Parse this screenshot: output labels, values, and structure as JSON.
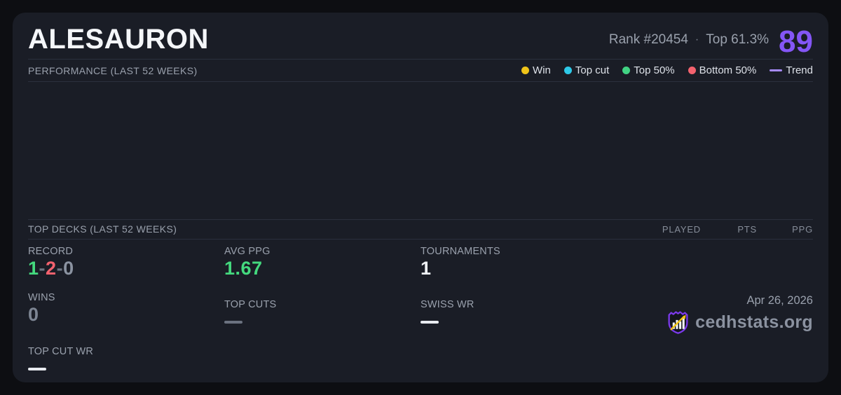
{
  "page": {
    "background": "#0d0e12",
    "card_background": "#1a1d26"
  },
  "header": {
    "title": "ALESAURON",
    "rank_text": "Rank #20454",
    "separator": "·",
    "top_percent_text": "Top 61.3%",
    "score": "89",
    "score_color": "#8456f5"
  },
  "performance": {
    "section_title": "PERFORMANCE (LAST 52 WEEKS)",
    "legend": [
      {
        "label": "Win",
        "color": "#f0c419",
        "icon": "dot"
      },
      {
        "label": "Top cut",
        "color": "#2ec9e8",
        "icon": "dot"
      },
      {
        "label": "Top 50%",
        "color": "#41d383",
        "icon": "dot"
      },
      {
        "label": "Bottom 50%",
        "color": "#f3626e",
        "icon": "dot"
      },
      {
        "label": "Trend",
        "color": "#a78bfa",
        "icon": "line"
      }
    ],
    "chart_points": []
  },
  "top_decks": {
    "section_title": "TOP DECKS (LAST 52 WEEKS)",
    "columns": [
      "PLAYED",
      "PTS",
      "PPG"
    ],
    "rows": []
  },
  "stats": {
    "record": {
      "label": "RECORD",
      "win": "1",
      "loss": "2",
      "draw": "0",
      "sep": "-",
      "win_color": "#44d97e",
      "loss_color": "#f4626e",
      "draw_color": "#6f7683"
    },
    "avg_ppg": {
      "label": "AVG PPG",
      "value": "1.67",
      "color": "#44d97e"
    },
    "tournaments": {
      "label": "TOURNAMENTS",
      "value": "1",
      "color": "#eef1f5"
    },
    "wins": {
      "label": "WINS",
      "value": "0",
      "color": "#7d8593"
    },
    "top_cuts": {
      "label": "TOP CUTS",
      "dash_color": "#6b7280"
    },
    "swiss_wr": {
      "label": "SWISS WR",
      "dash_color": "#e8ebf0"
    },
    "top_cut_wr": {
      "label": "TOP CUT WR",
      "dash_color": "#e8ebf0"
    }
  },
  "footer": {
    "date": "Apr 26, 2026",
    "brand": "cedhstats.org",
    "logo": "cedhstats-shield-chart-logo",
    "logo_shield_color": "#7c3aed",
    "logo_arrow_color": "#f0c419"
  }
}
